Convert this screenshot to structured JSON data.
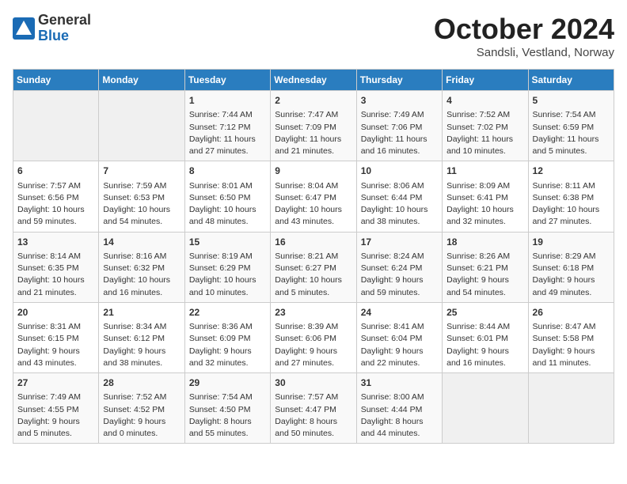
{
  "header": {
    "logo": {
      "general": "General",
      "blue": "Blue"
    },
    "title": "October 2024",
    "location": "Sandsli, Vestland, Norway"
  },
  "weekdays": [
    "Sunday",
    "Monday",
    "Tuesday",
    "Wednesday",
    "Thursday",
    "Friday",
    "Saturday"
  ],
  "weeks": [
    [
      {
        "day": "",
        "info": ""
      },
      {
        "day": "",
        "info": ""
      },
      {
        "day": "1",
        "info": "Sunrise: 7:44 AM\nSunset: 7:12 PM\nDaylight: 11 hours\nand 27 minutes."
      },
      {
        "day": "2",
        "info": "Sunrise: 7:47 AM\nSunset: 7:09 PM\nDaylight: 11 hours\nand 21 minutes."
      },
      {
        "day": "3",
        "info": "Sunrise: 7:49 AM\nSunset: 7:06 PM\nDaylight: 11 hours\nand 16 minutes."
      },
      {
        "day": "4",
        "info": "Sunrise: 7:52 AM\nSunset: 7:02 PM\nDaylight: 11 hours\nand 10 minutes."
      },
      {
        "day": "5",
        "info": "Sunrise: 7:54 AM\nSunset: 6:59 PM\nDaylight: 11 hours\nand 5 minutes."
      }
    ],
    [
      {
        "day": "6",
        "info": "Sunrise: 7:57 AM\nSunset: 6:56 PM\nDaylight: 10 hours\nand 59 minutes."
      },
      {
        "day": "7",
        "info": "Sunrise: 7:59 AM\nSunset: 6:53 PM\nDaylight: 10 hours\nand 54 minutes."
      },
      {
        "day": "8",
        "info": "Sunrise: 8:01 AM\nSunset: 6:50 PM\nDaylight: 10 hours\nand 48 minutes."
      },
      {
        "day": "9",
        "info": "Sunrise: 8:04 AM\nSunset: 6:47 PM\nDaylight: 10 hours\nand 43 minutes."
      },
      {
        "day": "10",
        "info": "Sunrise: 8:06 AM\nSunset: 6:44 PM\nDaylight: 10 hours\nand 38 minutes."
      },
      {
        "day": "11",
        "info": "Sunrise: 8:09 AM\nSunset: 6:41 PM\nDaylight: 10 hours\nand 32 minutes."
      },
      {
        "day": "12",
        "info": "Sunrise: 8:11 AM\nSunset: 6:38 PM\nDaylight: 10 hours\nand 27 minutes."
      }
    ],
    [
      {
        "day": "13",
        "info": "Sunrise: 8:14 AM\nSunset: 6:35 PM\nDaylight: 10 hours\nand 21 minutes."
      },
      {
        "day": "14",
        "info": "Sunrise: 8:16 AM\nSunset: 6:32 PM\nDaylight: 10 hours\nand 16 minutes."
      },
      {
        "day": "15",
        "info": "Sunrise: 8:19 AM\nSunset: 6:29 PM\nDaylight: 10 hours\nand 10 minutes."
      },
      {
        "day": "16",
        "info": "Sunrise: 8:21 AM\nSunset: 6:27 PM\nDaylight: 10 hours\nand 5 minutes."
      },
      {
        "day": "17",
        "info": "Sunrise: 8:24 AM\nSunset: 6:24 PM\nDaylight: 9 hours\nand 59 minutes."
      },
      {
        "day": "18",
        "info": "Sunrise: 8:26 AM\nSunset: 6:21 PM\nDaylight: 9 hours\nand 54 minutes."
      },
      {
        "day": "19",
        "info": "Sunrise: 8:29 AM\nSunset: 6:18 PM\nDaylight: 9 hours\nand 49 minutes."
      }
    ],
    [
      {
        "day": "20",
        "info": "Sunrise: 8:31 AM\nSunset: 6:15 PM\nDaylight: 9 hours\nand 43 minutes."
      },
      {
        "day": "21",
        "info": "Sunrise: 8:34 AM\nSunset: 6:12 PM\nDaylight: 9 hours\nand 38 minutes."
      },
      {
        "day": "22",
        "info": "Sunrise: 8:36 AM\nSunset: 6:09 PM\nDaylight: 9 hours\nand 32 minutes."
      },
      {
        "day": "23",
        "info": "Sunrise: 8:39 AM\nSunset: 6:06 PM\nDaylight: 9 hours\nand 27 minutes."
      },
      {
        "day": "24",
        "info": "Sunrise: 8:41 AM\nSunset: 6:04 PM\nDaylight: 9 hours\nand 22 minutes."
      },
      {
        "day": "25",
        "info": "Sunrise: 8:44 AM\nSunset: 6:01 PM\nDaylight: 9 hours\nand 16 minutes."
      },
      {
        "day": "26",
        "info": "Sunrise: 8:47 AM\nSunset: 5:58 PM\nDaylight: 9 hours\nand 11 minutes."
      }
    ],
    [
      {
        "day": "27",
        "info": "Sunrise: 7:49 AM\nSunset: 4:55 PM\nDaylight: 9 hours\nand 5 minutes."
      },
      {
        "day": "28",
        "info": "Sunrise: 7:52 AM\nSunset: 4:52 PM\nDaylight: 9 hours\nand 0 minutes."
      },
      {
        "day": "29",
        "info": "Sunrise: 7:54 AM\nSunset: 4:50 PM\nDaylight: 8 hours\nand 55 minutes."
      },
      {
        "day": "30",
        "info": "Sunrise: 7:57 AM\nSunset: 4:47 PM\nDaylight: 8 hours\nand 50 minutes."
      },
      {
        "day": "31",
        "info": "Sunrise: 8:00 AM\nSunset: 4:44 PM\nDaylight: 8 hours\nand 44 minutes."
      },
      {
        "day": "",
        "info": ""
      },
      {
        "day": "",
        "info": ""
      }
    ]
  ]
}
